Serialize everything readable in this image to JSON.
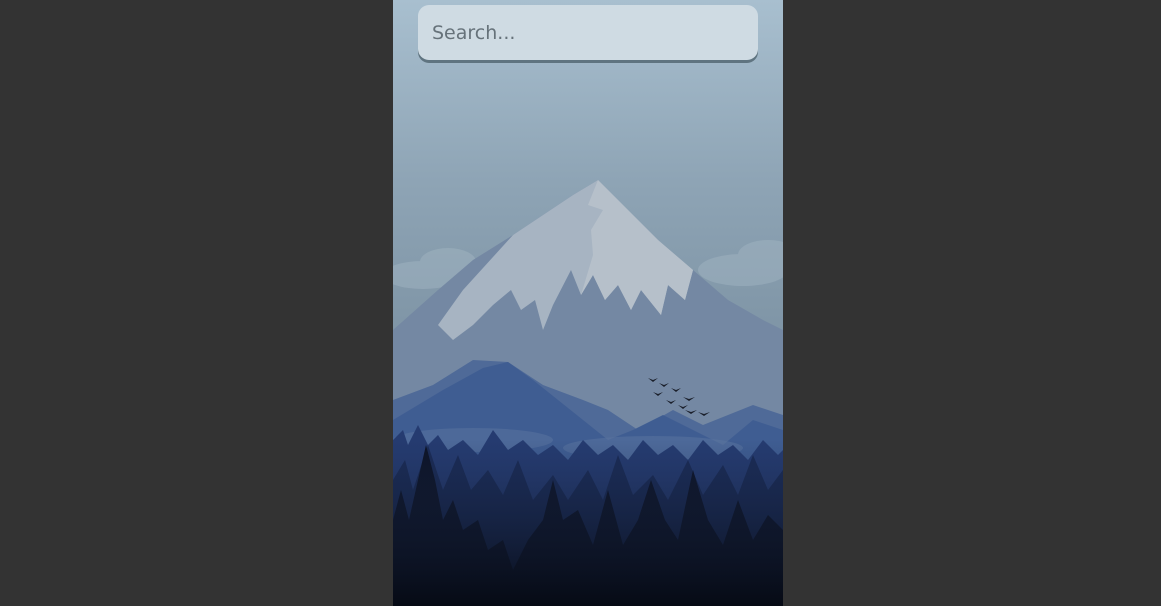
{
  "search": {
    "placeholder": "Search..."
  },
  "background": {
    "name": "mountain-landscape-wallpaper"
  },
  "colors": {
    "page_background": "#333333",
    "sky_top": "#a9bfcf",
    "sky_bottom": "#7d92a3",
    "search_bg": "#cfdbe3"
  }
}
